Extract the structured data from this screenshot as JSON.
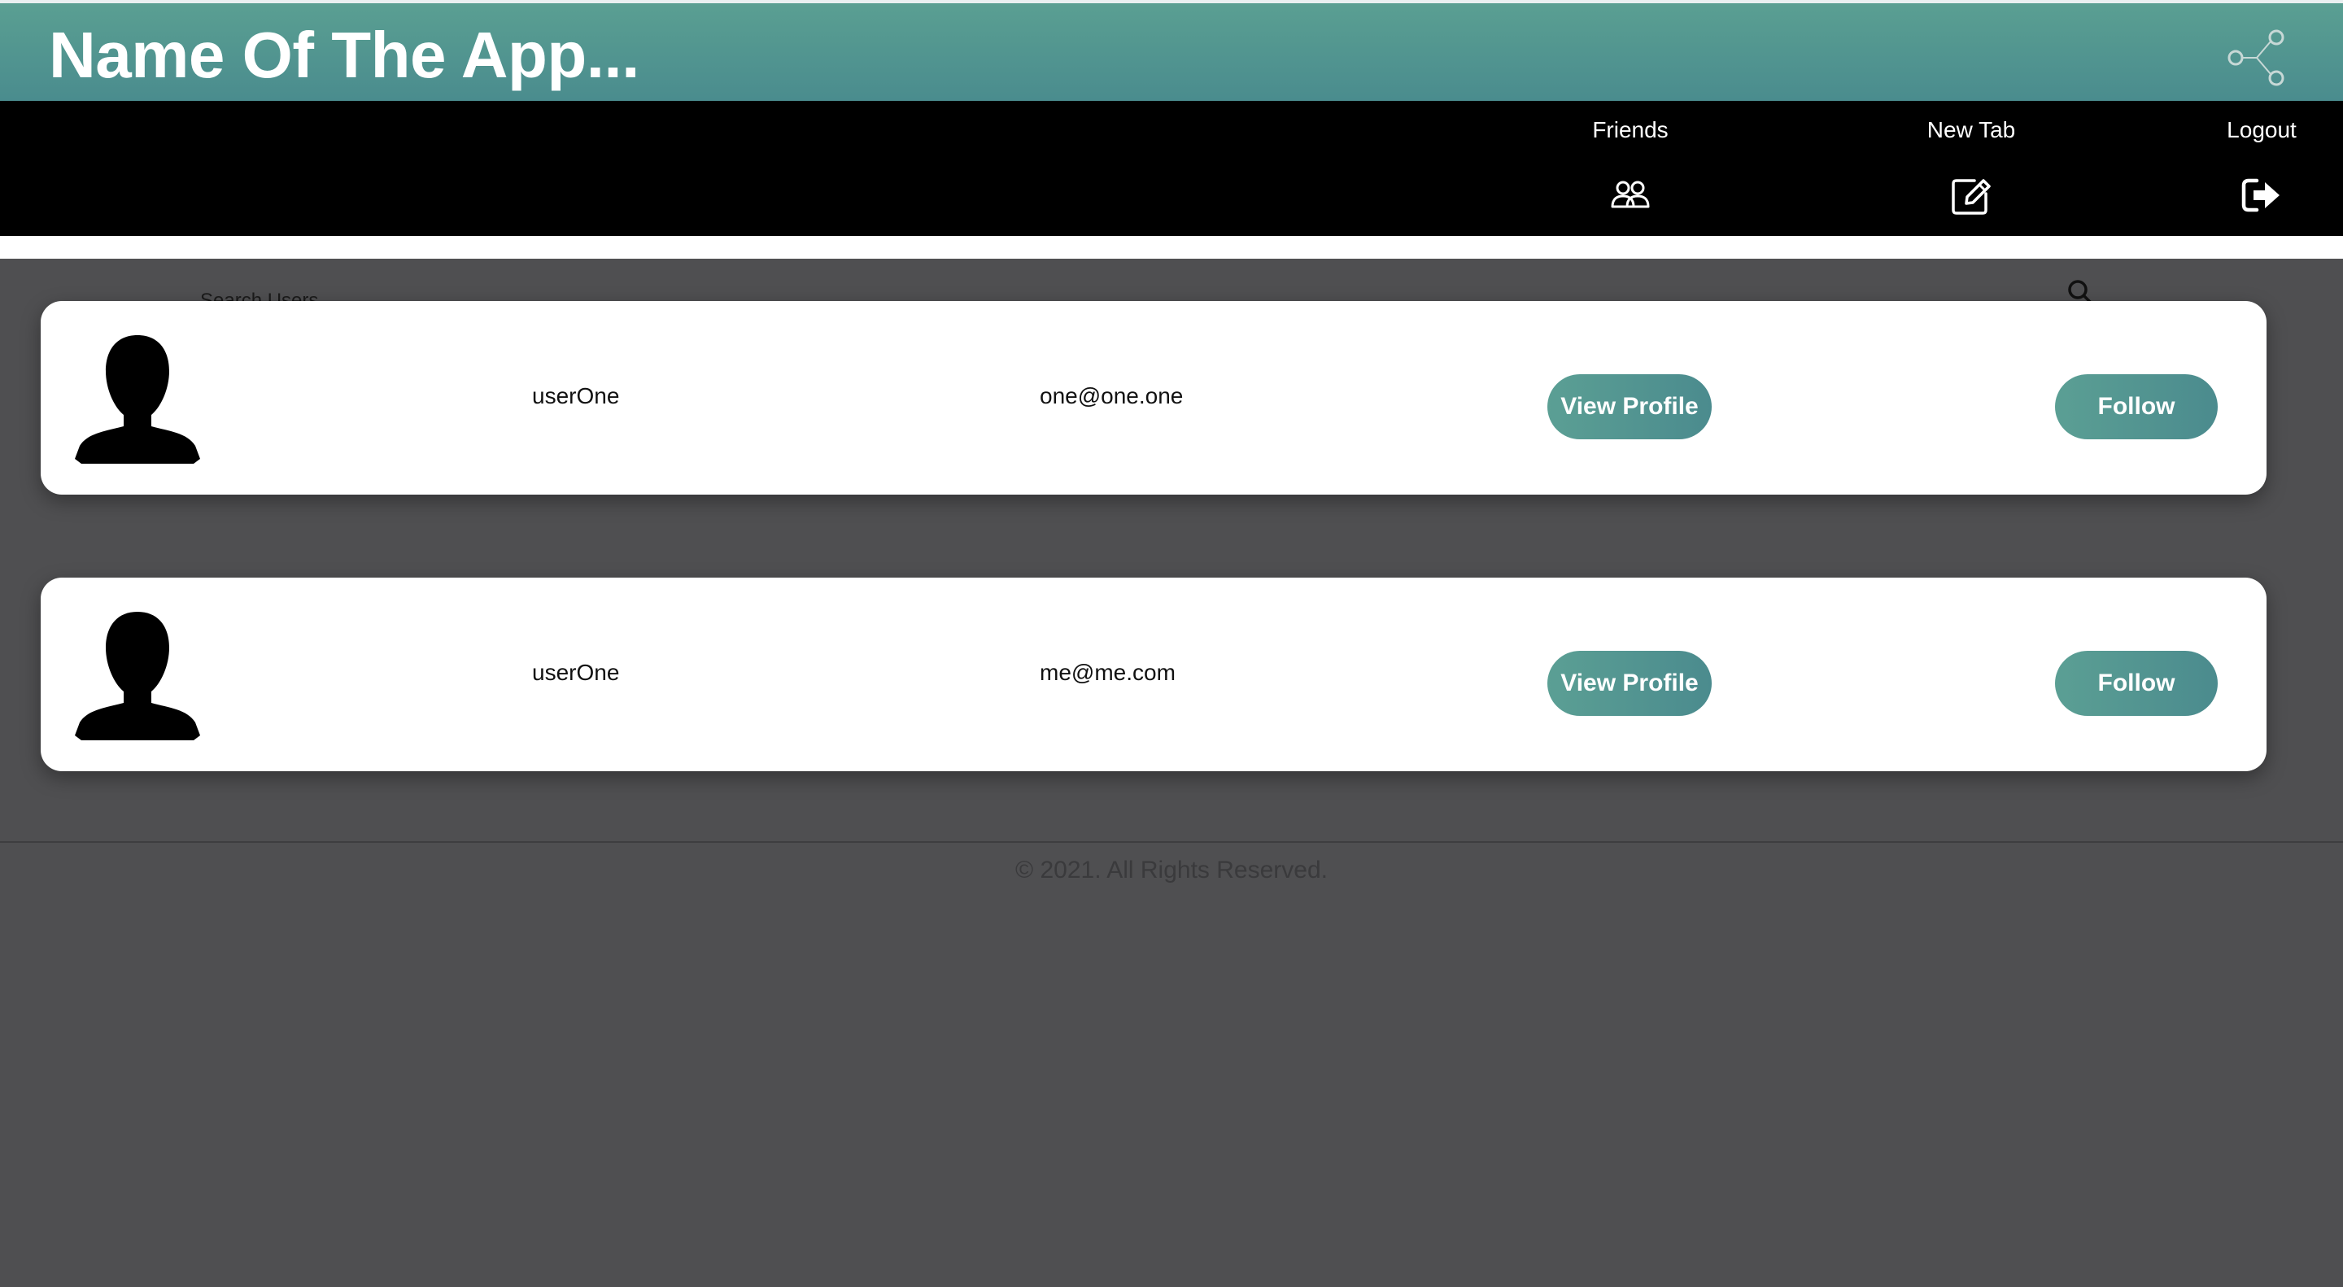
{
  "header": {
    "app_title": "Name Of The App...",
    "share_icon": "share-icon"
  },
  "nav": {
    "items": [
      {
        "label": "Friends",
        "icon": "friends-icon"
      },
      {
        "label": "New Tab",
        "icon": "edit-icon"
      },
      {
        "label": "Logout",
        "icon": "logout-icon"
      }
    ]
  },
  "search": {
    "label": "Search Users",
    "icon": "search-icon"
  },
  "users": [
    {
      "username": "userOne",
      "email": "one@one.one",
      "view_label": "View Profile",
      "follow_label": "Follow"
    },
    {
      "username": "userOne",
      "email": "me@me.com",
      "view_label": "View Profile",
      "follow_label": "Follow"
    }
  ],
  "footer": {
    "copyright": "© 2021. All Rights Reserved."
  },
  "colors": {
    "accent": "#4f9590",
    "navbar": "#000000",
    "background": "#4f4f51"
  }
}
